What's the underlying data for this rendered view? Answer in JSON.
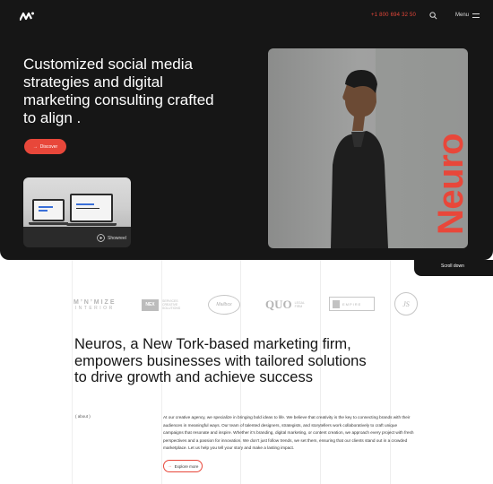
{
  "header": {
    "logo_icon": "brand-logo",
    "phone": "+1 800 694 32 50",
    "search_icon": "search-icon",
    "menu_label": "Menu",
    "menu_icon": "hamburger-icon"
  },
  "hero": {
    "headline": "Customized social media strategies and digital marketing consulting crafted to align .",
    "discover_label": "Discover",
    "showreel_label": "Showreel",
    "brand_vertical": "Neuro",
    "scroll_label": "Scroll down"
  },
  "clients": {
    "minimize_top": "M’N’MIZE",
    "minimize_bottom": "INTERIOR",
    "box_mark": "NEX",
    "box_text": "SERVICES CREATIVE SOLUTIONS",
    "script_mark": "Mailbox",
    "quo_mark": "QUO",
    "quo_text": "LEGAL FIRM",
    "empire_text": "EMPIRE",
    "monogram": "JS"
  },
  "about": {
    "statement": "Neuros, a New Tork-based marketing firm, empowers businesses with tailored solutions to drive growth and achieve success",
    "label": "( about )",
    "body": "At our creative agency, we specialize in bringing bold ideas to life. We believe that creativity is the key to connecting brands with their audiences in meaningful ways. Our team of talented designers, strategists, and storytellers work collaboratively to craft unique campaigns that resonate and inspire. Whether it’s branding, digital marketing, or content creation, we approach every project with fresh perspectives and a passion for innovation. We don’t just follow trends, we set them, ensuring that our clients stand out in a crowded marketplace. Let us help you tell your story and make a lasting impact.",
    "explore_label": "Explore more"
  },
  "colors": {
    "accent": "#e8473a",
    "dark": "#161616"
  }
}
